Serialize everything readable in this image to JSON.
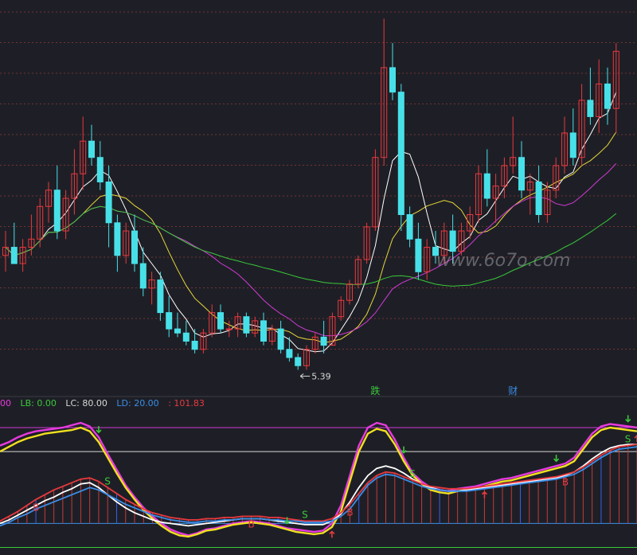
{
  "chart_data": [
    {
      "type": "candlestick",
      "title": "",
      "price_annotation": "5.39",
      "event_markers": [
        {
          "label": "跌",
          "x_index": 43
        },
        {
          "label": "财",
          "x_index": 59
        }
      ],
      "moving_averages": [
        "white",
        "yellow",
        "magenta",
        "green"
      ],
      "watermark": "www.6o7o.com",
      "colors": {
        "up": "#e8393e",
        "down": "#48e0e8",
        "ma_short": "#ffffff",
        "ma_mid": "#e8d83a",
        "ma_long": "#d03ad6",
        "ma_longest": "#3ac93a",
        "grid": "#7a3535",
        "annotation": "#d8d8d8"
      },
      "grid": true,
      "candles": [
        [
          6.5,
          6.8,
          6.3,
          6.6
        ],
        [
          6.6,
          6.9,
          6.4,
          6.4
        ],
        [
          6.4,
          6.7,
          6.3,
          6.6
        ],
        [
          6.6,
          7.0,
          6.5,
          6.7
        ],
        [
          6.7,
          7.2,
          6.6,
          7.1
        ],
        [
          7.1,
          7.4,
          6.9,
          7.3
        ],
        [
          7.3,
          7.6,
          6.7,
          6.8
        ],
        [
          6.8,
          7.3,
          6.7,
          7.2
        ],
        [
          7.2,
          7.8,
          7.0,
          7.5
        ],
        [
          7.5,
          8.2,
          7.3,
          7.9
        ],
        [
          7.9,
          8.1,
          7.6,
          7.7
        ],
        [
          7.7,
          7.9,
          7.3,
          7.4
        ],
        [
          7.4,
          7.6,
          6.6,
          6.9
        ],
        [
          6.9,
          7.0,
          6.3,
          6.5
        ],
        [
          6.5,
          6.9,
          6.4,
          6.8
        ],
        [
          6.8,
          7.0,
          6.3,
          6.4
        ],
        [
          6.4,
          6.6,
          6.0,
          6.1
        ],
        [
          6.1,
          6.3,
          5.9,
          6.2
        ],
        [
          6.2,
          6.3,
          5.7,
          5.8
        ],
        [
          5.8,
          6.0,
          5.5,
          5.6
        ],
        [
          5.6,
          5.8,
          5.5,
          5.55
        ],
        [
          5.55,
          5.7,
          5.4,
          5.45
        ],
        [
          5.45,
          5.6,
          5.3,
          5.35
        ],
        [
          5.35,
          5.6,
          5.3,
          5.55
        ],
        [
          5.55,
          5.9,
          5.5,
          5.8
        ],
        [
          5.8,
          5.9,
          5.55,
          5.6
        ],
        [
          5.6,
          5.7,
          5.5,
          5.6
        ],
        [
          5.6,
          5.8,
          5.5,
          5.75
        ],
        [
          5.75,
          5.8,
          5.5,
          5.55
        ],
        [
          5.55,
          5.75,
          5.5,
          5.7
        ],
        [
          5.7,
          5.8,
          5.4,
          5.45
        ],
        [
          5.45,
          5.65,
          5.4,
          5.6
        ],
        [
          5.6,
          5.7,
          5.3,
          5.35
        ],
        [
          5.35,
          5.5,
          5.2,
          5.25
        ],
        [
          5.25,
          5.3,
          5.1,
          5.15
        ],
        [
          5.15,
          5.4,
          5.1,
          5.35
        ],
        [
          5.35,
          5.55,
          5.3,
          5.5
        ],
        [
          5.5,
          5.7,
          5.3,
          5.4
        ],
        [
          5.4,
          5.8,
          5.4,
          5.75
        ],
        [
          5.75,
          6.0,
          5.7,
          5.95
        ],
        [
          5.95,
          6.2,
          5.9,
          6.15
        ],
        [
          6.15,
          6.5,
          6.1,
          6.45
        ],
        [
          6.45,
          6.9,
          6.4,
          6.85
        ],
        [
          6.85,
          7.8,
          6.8,
          7.7
        ],
        [
          7.7,
          9.4,
          7.6,
          8.8
        ],
        [
          8.8,
          9.1,
          8.4,
          8.5
        ],
        [
          8.5,
          8.6,
          6.8,
          7.0
        ],
        [
          7.0,
          7.1,
          6.6,
          6.7
        ],
        [
          6.7,
          6.9,
          6.2,
          6.3
        ],
        [
          6.3,
          6.7,
          6.2,
          6.6
        ],
        [
          6.6,
          6.8,
          6.4,
          6.5
        ],
        [
          6.5,
          6.9,
          6.4,
          6.8
        ],
        [
          6.8,
          7.0,
          6.4,
          6.55
        ],
        [
          6.55,
          6.9,
          6.5,
          6.8
        ],
        [
          6.8,
          7.1,
          6.7,
          7.0
        ],
        [
          7.0,
          7.6,
          6.9,
          7.5
        ],
        [
          7.5,
          7.8,
          7.1,
          7.2
        ],
        [
          7.2,
          7.5,
          6.9,
          7.35
        ],
        [
          7.35,
          7.7,
          7.2,
          7.6
        ],
        [
          7.6,
          8.2,
          7.5,
          7.7
        ],
        [
          7.7,
          7.9,
          7.2,
          7.3
        ],
        [
          7.3,
          7.5,
          7.0,
          7.4
        ],
        [
          7.4,
          7.6,
          6.9,
          7.0
        ],
        [
          7.0,
          7.4,
          6.9,
          7.3
        ],
        [
          7.3,
          7.7,
          7.2,
          7.6
        ],
        [
          7.6,
          8.2,
          7.5,
          8.0
        ],
        [
          8.0,
          8.3,
          7.6,
          7.7
        ],
        [
          7.7,
          8.6,
          7.6,
          8.4
        ],
        [
          8.4,
          8.8,
          8.1,
          8.2
        ],
        [
          8.2,
          8.9,
          8.0,
          8.6
        ],
        [
          8.6,
          8.8,
          8.1,
          8.3
        ],
        [
          8.3,
          9.1,
          8.0,
          9.0
        ]
      ]
    },
    {
      "type": "line",
      "title": "",
      "legend": [
        {
          "text": "00",
          "color": "#e83ae0"
        },
        {
          "text": "LB: 0.00",
          "color": "#3ac93a"
        },
        {
          "text": "LC: 80.00",
          "color": "#d8d8d8"
        },
        {
          "text": "LD: 20.00",
          "color": "#3a8ee8"
        },
        {
          "text": ": 101.83",
          "color": "#e8393e"
        }
      ],
      "ylim": [
        -5,
        110
      ],
      "reference_lines": [
        {
          "value": 100,
          "color": "#d03ad6"
        },
        {
          "value": 80,
          "color": "#d8d8d8"
        },
        {
          "value": 20,
          "color": "#3a8ee8"
        },
        {
          "value": 0,
          "color": "#3ac93a"
        }
      ],
      "series": [
        {
          "color": "#e83ae0",
          "values": [
            85,
            88,
            92,
            95,
            97,
            98,
            99,
            100,
            102,
            104,
            101,
            92,
            78,
            65,
            52,
            42,
            33,
            26,
            20,
            15,
            12,
            10,
            12,
            15,
            16,
            18,
            20,
            21,
            22,
            21,
            20,
            18,
            16,
            15,
            14,
            13,
            14,
            20,
            35,
            60,
            85,
            100,
            104,
            102,
            90,
            75,
            62,
            55,
            50,
            48,
            47,
            49,
            50,
            51,
            53,
            55,
            57,
            58,
            60,
            62,
            64,
            66,
            68,
            70,
            75,
            85,
            95,
            101,
            103,
            102,
            101,
            100
          ]
        },
        {
          "color": "#f0e020",
          "values": [
            80,
            84,
            88,
            91,
            93,
            95,
            96,
            97,
            98,
            100,
            97,
            88,
            75,
            62,
            50,
            40,
            31,
            24,
            18,
            13,
            10,
            9,
            11,
            14,
            15,
            17,
            19,
            20,
            21,
            20,
            19,
            17,
            15,
            13,
            12,
            11,
            12,
            17,
            30,
            55,
            80,
            95,
            99,
            97,
            86,
            72,
            60,
            53,
            48,
            46,
            45,
            47,
            48,
            49,
            51,
            53,
            55,
            56,
            58,
            60,
            62,
            64,
            66,
            68,
            72,
            82,
            92,
            98,
            100,
            99,
            98,
            97
          ]
        },
        {
          "color": "#ffffff",
          "values": [
            20,
            23,
            27,
            31,
            35,
            39,
            42,
            46,
            49,
            53,
            54,
            50,
            44,
            38,
            33,
            29,
            26,
            23,
            21,
            20,
            19,
            18,
            19,
            20,
            21,
            22,
            23,
            24,
            24,
            24,
            23,
            22,
            21,
            20,
            19,
            19,
            19,
            22,
            28,
            38,
            50,
            60,
            66,
            68,
            66,
            62,
            57,
            53,
            50,
            48,
            47,
            47,
            48,
            49,
            50,
            51,
            52,
            53,
            54,
            55,
            56,
            57,
            58,
            60,
            63,
            68,
            74,
            79,
            83,
            85,
            86,
            86
          ]
        },
        {
          "color": "#e8393e",
          "values": [
            22,
            26,
            30,
            35,
            40,
            44,
            48,
            51,
            54,
            57,
            58,
            55,
            50,
            45,
            40,
            36,
            32,
            29,
            27,
            25,
            24,
            23,
            23,
            24,
            24,
            25,
            25,
            26,
            26,
            26,
            25,
            25,
            24,
            23,
            22,
            22,
            22,
            24,
            29,
            36,
            45,
            54,
            60,
            63,
            62,
            59,
            56,
            53,
            51,
            50,
            49,
            49,
            49,
            50,
            51,
            52,
            53,
            54,
            55,
            56,
            57,
            58,
            59,
            61,
            63,
            67,
            72,
            77,
            81,
            84,
            85,
            86
          ]
        },
        {
          "color": "#3a8ee8",
          "values": [
            18,
            21,
            25,
            28,
            32,
            35,
            38,
            41,
            44,
            47,
            50,
            48,
            44,
            40,
            36,
            33,
            30,
            27,
            25,
            23,
            22,
            21,
            21,
            22,
            22,
            23,
            23,
            24,
            24,
            24,
            23,
            23,
            22,
            22,
            21,
            21,
            21,
            22,
            26,
            32,
            42,
            52,
            58,
            61,
            60,
            57,
            54,
            51,
            49,
            48,
            47,
            47,
            47,
            48,
            49,
            50,
            51,
            52,
            53,
            54,
            55,
            56,
            57,
            59,
            61,
            65,
            70,
            75,
            79,
            82,
            83,
            84
          ]
        }
      ],
      "signals": [
        {
          "type": "B",
          "x_index": 4,
          "color": "#e8393e"
        },
        {
          "type": "S",
          "x_index": 12,
          "color": "#3ac93a"
        },
        {
          "type": "B",
          "x_index": 28,
          "color": "#e8393e"
        },
        {
          "type": "S",
          "x_index": 34,
          "color": "#3ac93a"
        },
        {
          "type": "B",
          "x_index": 39,
          "color": "#e8393e"
        },
        {
          "type": "S",
          "x_index": 46,
          "color": "#3ac93a"
        },
        {
          "type": "B",
          "x_index": 63,
          "color": "#e8393e"
        },
        {
          "type": "S",
          "x_index": 70,
          "color": "#3ac93a"
        }
      ],
      "arrows": [
        {
          "direction": "down",
          "x_index": 11,
          "color": "#3ac93a"
        },
        {
          "direction": "down",
          "x_index": 32,
          "color": "#3ac93a"
        },
        {
          "direction": "up",
          "x_index": 37,
          "color": "#e8393e"
        },
        {
          "direction": "down",
          "x_index": 45,
          "color": "#3ac93a"
        },
        {
          "direction": "up",
          "x_index": 54,
          "color": "#e8393e"
        },
        {
          "direction": "down",
          "x_index": 62,
          "color": "#3ac93a"
        },
        {
          "direction": "down",
          "x_index": 70,
          "color": "#3ac93a"
        },
        {
          "direction": "up",
          "x_index": 71,
          "color": "#e8393e"
        }
      ]
    }
  ]
}
